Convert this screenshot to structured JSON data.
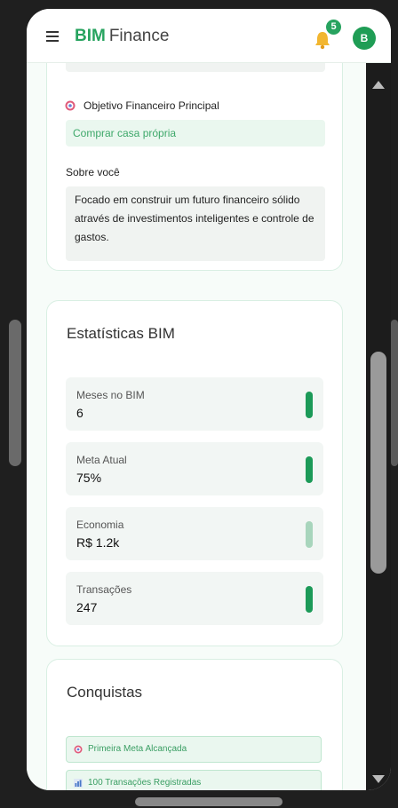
{
  "header": {
    "brand_bold": "BIM",
    "brand_rest": "Finance",
    "notification_count": "5",
    "avatar_initial": "B"
  },
  "profile": {
    "goal_label": "Objetivo Financeiro Principal",
    "goal_value": "Comprar casa própria",
    "about_label": "Sobre você",
    "about_text": "Focado em construir um futuro financeiro sólido através de investimentos inteligentes e controle de gastos."
  },
  "stats": {
    "title": "Estatísticas BIM",
    "items": [
      {
        "label": "Meses no BIM",
        "value": "6"
      },
      {
        "label": "Meta Atual",
        "value": "75%"
      },
      {
        "label": "Economia",
        "value": "R$ 1.2k"
      },
      {
        "label": "Transações",
        "value": "247"
      }
    ]
  },
  "achievements": {
    "title": "Conquistas",
    "items": [
      {
        "label": "Primeira Meta Alcançada",
        "icon": "target-icon"
      },
      {
        "label": "100 Transações Registradas",
        "icon": "chart-icon"
      }
    ]
  },
  "colors": {
    "accent": "#27a35f",
    "bar": "#1c9a58",
    "bar_light": "#a8d5bc"
  }
}
